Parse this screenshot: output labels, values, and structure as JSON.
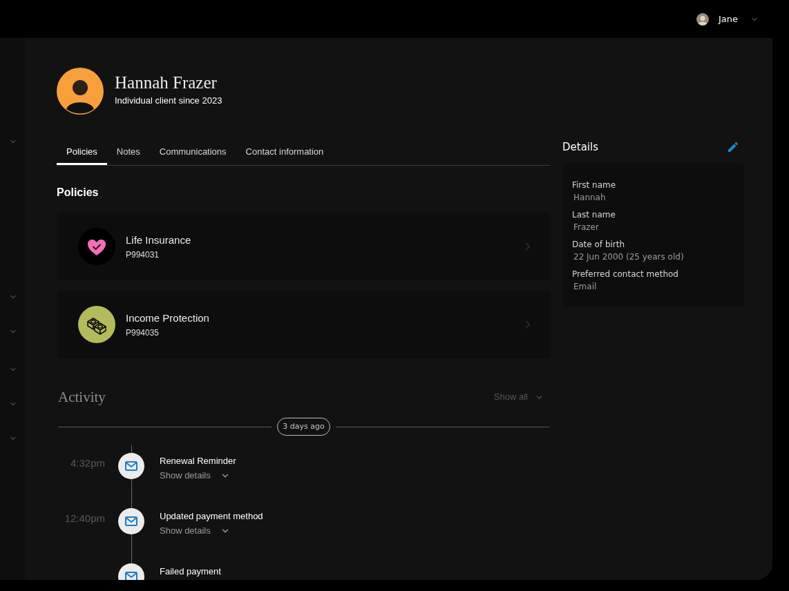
{
  "top_bar": {
    "user": {
      "name": "Jane"
    }
  },
  "client": {
    "name": "Hannah Frazer",
    "subtitle": "Individual client since 2023"
  },
  "tabs": [
    {
      "label": "Policies",
      "selected": true
    },
    {
      "label": "Notes",
      "selected": false
    },
    {
      "label": "Communications",
      "selected": false
    },
    {
      "label": "Contact information",
      "selected": false
    }
  ],
  "policies": {
    "title": "Policies",
    "items": [
      {
        "kind": "life",
        "name": "Life Insurance",
        "number": "P994031"
      },
      {
        "kind": "income",
        "name": "Income Protection",
        "number": "P994035"
      }
    ]
  },
  "activity": {
    "title": "Activity",
    "show_all": "Show all",
    "groups": [
      {
        "label": "3 days ago",
        "events": [
          {
            "kind": "email",
            "time": "4:32pm",
            "title": "Renewal Reminder",
            "details_toggle": {
              "label": "Show details",
              "expanded": false
            }
          },
          {
            "kind": "email",
            "time": "12:40pm",
            "title": "Updated payment method",
            "details_toggle": {
              "label": "Show details",
              "expanded": false
            }
          },
          {
            "kind": "email",
            "title": "Failed payment"
          }
        ]
      }
    ]
  },
  "details": {
    "title": "Details",
    "fields": [
      {
        "label": "First name",
        "value": "Hannah"
      },
      {
        "label": "Last name",
        "value": "Frazer"
      },
      {
        "label": "Date of birth",
        "value": "22 Jun 2000 (25 years old)"
      },
      {
        "label": "Preferred contact method",
        "value": "Email"
      }
    ]
  }
}
